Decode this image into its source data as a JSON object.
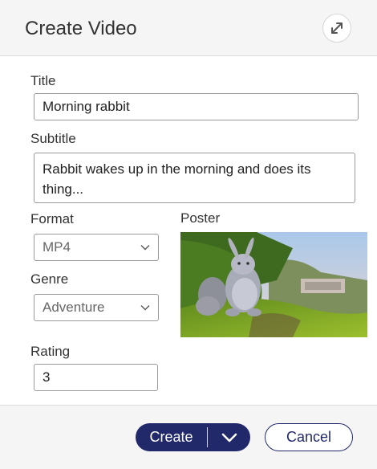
{
  "dialog": {
    "title": "Create Video",
    "expand_icon": "expand-arrows-icon"
  },
  "form": {
    "title_label": "Title",
    "title_value": "Morning rabbit",
    "subtitle_label": "Subtitle",
    "subtitle_value": "Rabbit wakes up in the morning and does its thing...",
    "format_label": "Format",
    "format_value": "MP4",
    "genre_label": "Genre",
    "genre_value": "Adventure",
    "poster_label": "Poster",
    "rating_label": "Rating",
    "rating_value": "3"
  },
  "footer": {
    "create_label": "Create",
    "cancel_label": "Cancel",
    "accent_color": "#22296a"
  }
}
